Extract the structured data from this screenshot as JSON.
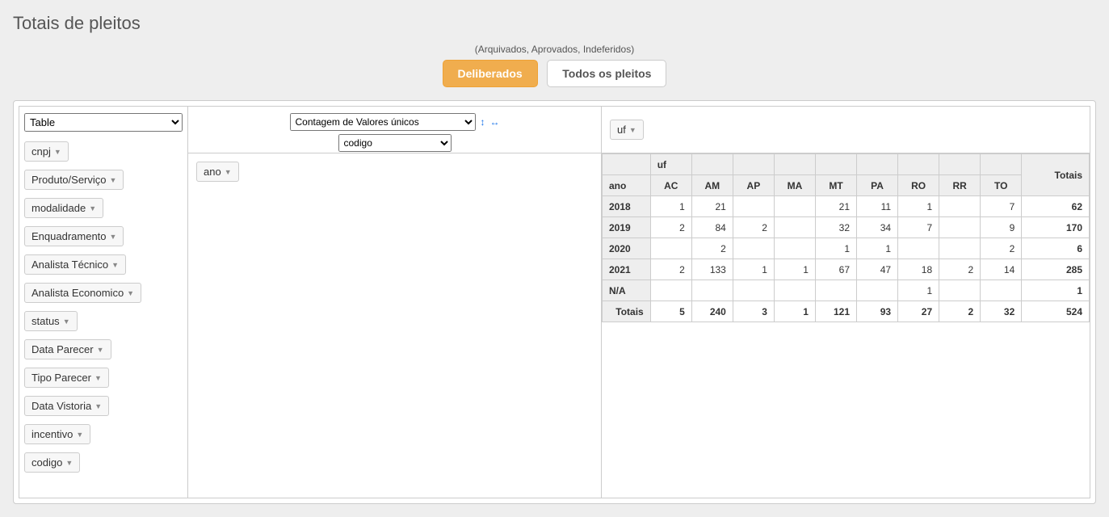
{
  "title": "Totais de pleitos",
  "subtitle": "(Arquivados, Aprovados, Indeferidos)",
  "toggle": {
    "deliberados": "Deliberados",
    "todos": "Todos os pleitos"
  },
  "renderer": {
    "selected": "Table"
  },
  "aggregator": {
    "selected": "Contagem de Valores únicos",
    "value_field": "codigo"
  },
  "sort_icons": {
    "a": "↕",
    "b": "↔"
  },
  "unused_fields": [
    "cnpj",
    "Produto/Serviço",
    "modalidade",
    "Enquadramento",
    "Analista Técnico",
    "Analista Economico",
    "status",
    "Data Parecer",
    "Tipo Parecer",
    "Data Vistoria",
    "incentivo",
    "codigo"
  ],
  "row_fields": [
    "ano"
  ],
  "col_fields": [
    "uf"
  ],
  "pivot": {
    "col_label": "uf",
    "row_label": "ano",
    "totals_label": "Totais",
    "columns": [
      "AC",
      "AM",
      "AP",
      "MA",
      "MT",
      "PA",
      "RO",
      "RR",
      "TO"
    ],
    "rows": [
      {
        "label": "2018",
        "cells": [
          "1",
          "21",
          "",
          "",
          "21",
          "11",
          "1",
          "",
          "7"
        ],
        "total": "62"
      },
      {
        "label": "2019",
        "cells": [
          "2",
          "84",
          "2",
          "",
          "32",
          "34",
          "7",
          "",
          "9"
        ],
        "total": "170"
      },
      {
        "label": "2020",
        "cells": [
          "",
          "2",
          "",
          "",
          "1",
          "1",
          "",
          "",
          "2"
        ],
        "total": "6"
      },
      {
        "label": "2021",
        "cells": [
          "2",
          "133",
          "1",
          "1",
          "67",
          "47",
          "18",
          "2",
          "14"
        ],
        "total": "285"
      },
      {
        "label": "N/A",
        "cells": [
          "",
          "",
          "",
          "",
          "",
          "",
          "1",
          "",
          ""
        ],
        "total": "1"
      }
    ],
    "col_totals": [
      "5",
      "240",
      "3",
      "1",
      "121",
      "93",
      "27",
      "2",
      "32"
    ],
    "grand_total": "524"
  }
}
